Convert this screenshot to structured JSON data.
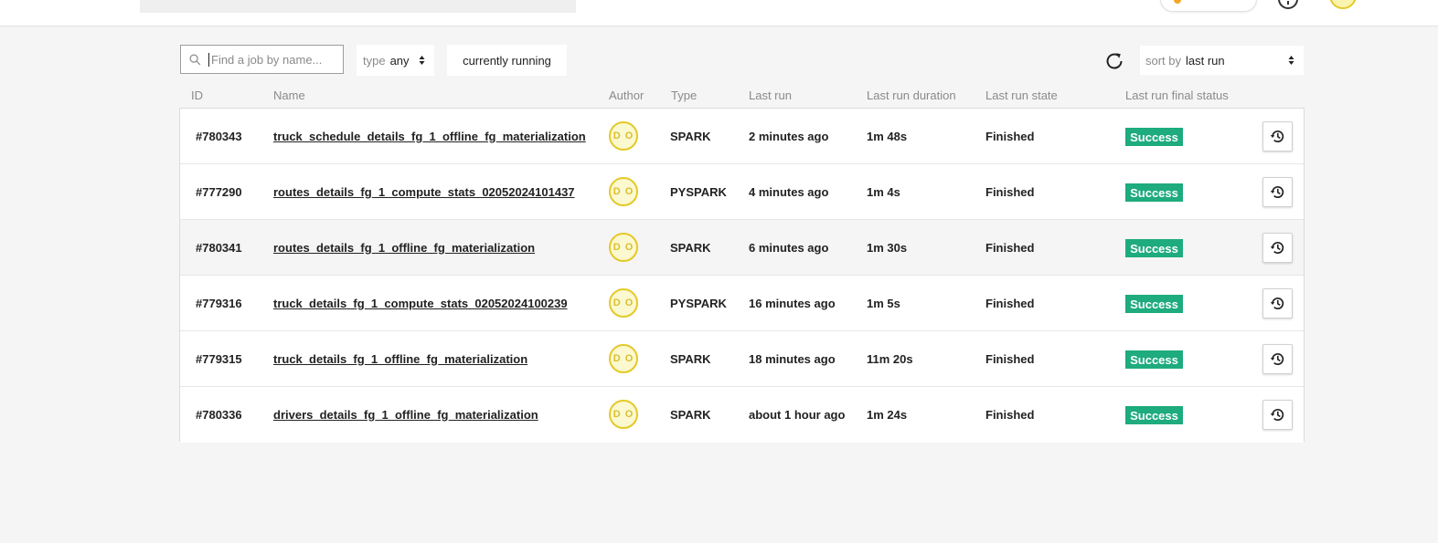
{
  "header": {
    "search_value": "",
    "icons": [
      "flame-icon",
      "help-icon",
      "user-avatar"
    ]
  },
  "toolbar": {
    "search_placeholder": "Find a job by name...",
    "type_label": "type",
    "type_value": "any",
    "currently_running_label": "currently running",
    "sort_label": "sort by",
    "sort_value": "last run",
    "icons": [
      "search-icon",
      "refresh-icon",
      "sort-arrows-icon"
    ]
  },
  "table": {
    "columns": [
      "ID",
      "Name",
      "Author",
      "Type",
      "Last run",
      "Last run duration",
      "Last run state",
      "Last run final status"
    ],
    "rows": [
      {
        "id": "#780343",
        "name": "truck_schedule_details_fg_1_offline_fg_materialization",
        "author": "D O",
        "type": "SPARK",
        "last_run": "2 minutes ago",
        "duration": "1m 48s",
        "state": "Finished",
        "status": "Success"
      },
      {
        "id": "#777290",
        "name": "routes_details_fg_1_compute_stats_02052024101437",
        "author": "D O",
        "type": "PYSPARK",
        "last_run": "4 minutes ago",
        "duration": "1m 4s",
        "state": "Finished",
        "status": "Success"
      },
      {
        "id": "#780341",
        "name": "routes_details_fg_1_offline_fg_materialization",
        "author": "D O",
        "type": "SPARK",
        "last_run": "6 minutes ago",
        "duration": "1m 30s",
        "state": "Finished",
        "status": "Success"
      },
      {
        "id": "#779316",
        "name": "truck_details_fg_1_compute_stats_02052024100239",
        "author": "D O",
        "type": "PYSPARK",
        "last_run": "16 minutes ago",
        "duration": "1m 5s",
        "state": "Finished",
        "status": "Success"
      },
      {
        "id": "#779315",
        "name": "truck_details_fg_1_offline_fg_materialization",
        "author": "D O",
        "type": "SPARK",
        "last_run": "18 minutes ago",
        "duration": "11m 20s",
        "state": "Finished",
        "status": "Success"
      },
      {
        "id": "#780336",
        "name": "drivers_details_fg_1_offline_fg_materialization",
        "author": "D O",
        "type": "SPARK",
        "last_run": "about 1 hour ago",
        "duration": "1m 24s",
        "state": "Finished",
        "status": "Success"
      }
    ]
  },
  "colors": {
    "success": "#1eab7e",
    "avatar_border": "#e4c928",
    "avatar_fill": "#fcf8cf",
    "background": "#f5f5f5"
  }
}
